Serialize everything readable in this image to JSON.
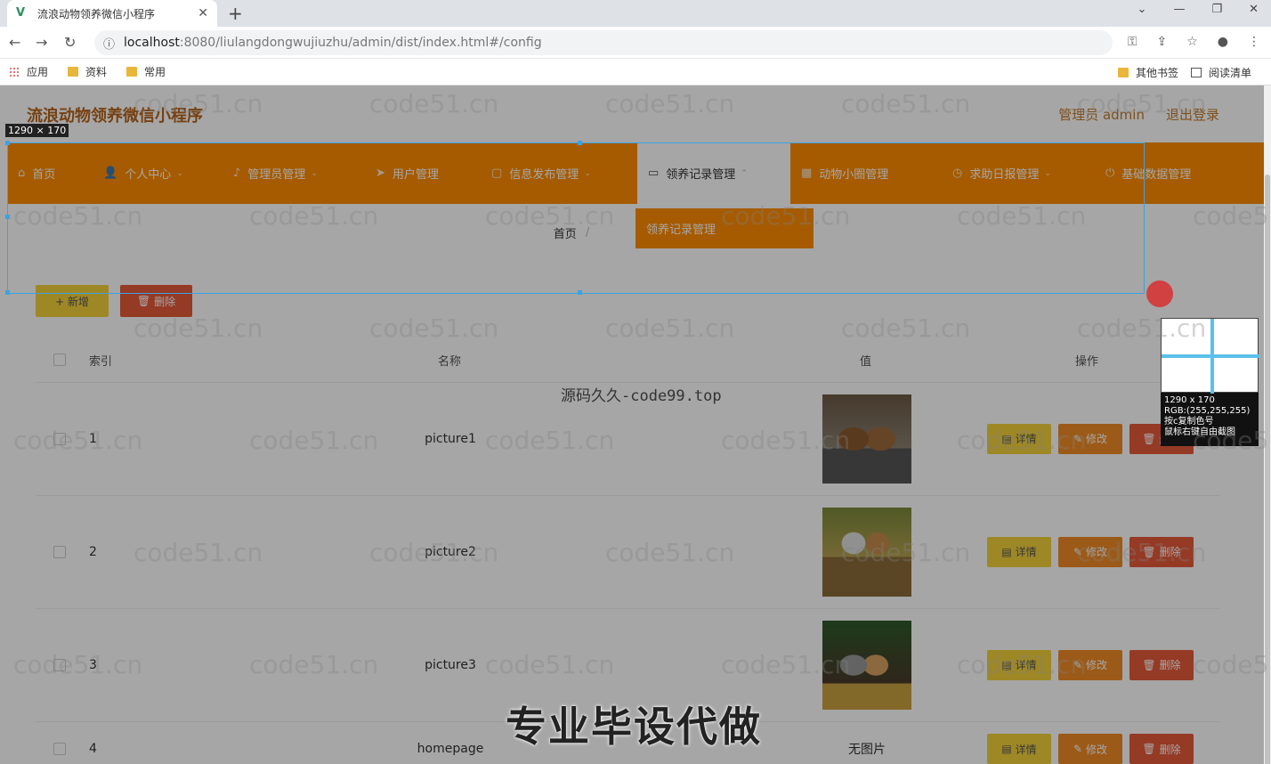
{
  "browser": {
    "tab_title": "流浪动物领养微信小程序",
    "new_tab": "+",
    "url_host": "localhost",
    "url_rest": ":8080/liulangdongwujiuzhu/admin/dist/index.html#/config",
    "bookmarks": [
      "应用",
      "资料",
      "常用"
    ],
    "bookmarks_right": [
      "其他书签",
      "阅读清单"
    ]
  },
  "header": {
    "title": "流浪动物领养微信小程序",
    "user": "管理员 admin",
    "logout": "退出登录"
  },
  "nav": [
    {
      "label": "首页",
      "icon": "home-icon",
      "caret": false,
      "active": false
    },
    {
      "label": "个人中心",
      "icon": "user-icon",
      "caret": true,
      "active": false
    },
    {
      "label": "管理员管理",
      "icon": "mic-icon",
      "caret": true,
      "active": false
    },
    {
      "label": "用户管理",
      "icon": "send-icon",
      "caret": false,
      "active": false
    },
    {
      "label": "信息发布管理",
      "icon": "doc-icon",
      "caret": true,
      "active": false
    },
    {
      "label": "领养记录管理",
      "icon": "monitor-icon",
      "caret": true,
      "active": true
    },
    {
      "label": "动物小圈管理",
      "icon": "calendar-icon",
      "caret": false,
      "active": false
    },
    {
      "label": "求助日报管理",
      "icon": "clock-icon",
      "caret": true,
      "active": false
    },
    {
      "label": "基础数据管理",
      "icon": "power-icon",
      "caret": false,
      "active": false
    }
  ],
  "dropdown": {
    "item": "领养记录管理"
  },
  "breadcrumb": {
    "home": "首页",
    "sep": "/"
  },
  "toolbar": {
    "add": "+ 新增",
    "delete": "删除"
  },
  "table": {
    "headers": [
      "索引",
      "名称",
      "值",
      "操作"
    ],
    "rows": [
      {
        "index": "1",
        "name": "picture1",
        "value": "",
        "has_image": true
      },
      {
        "index": "2",
        "name": "picture2",
        "value": "",
        "has_image": true
      },
      {
        "index": "3",
        "name": "picture3",
        "value": "",
        "has_image": true
      },
      {
        "index": "4",
        "name": "homepage",
        "value": "无图片",
        "has_image": false
      }
    ],
    "ops": {
      "detail": "详情",
      "edit": "修改",
      "delete": "删除"
    }
  },
  "overlay": {
    "size_tag": "1290 × 170",
    "zoom_size": "1290 x 170",
    "zoom_rgb": "RGB:(255,255,255)",
    "zoom_copy": "按c复制色号",
    "zoom_free": "鼠标右键自由截图"
  },
  "watermark": {
    "text": "code51.cn",
    "center": "源码久久-code99.top",
    "caption": "专业毕设代做"
  },
  "colors": {
    "nav": "#ff8c00",
    "title": "#b5651d",
    "btn_yellow": "#f3d23b",
    "btn_red": "#e55a3a",
    "btn_orange": "#f08a25"
  }
}
